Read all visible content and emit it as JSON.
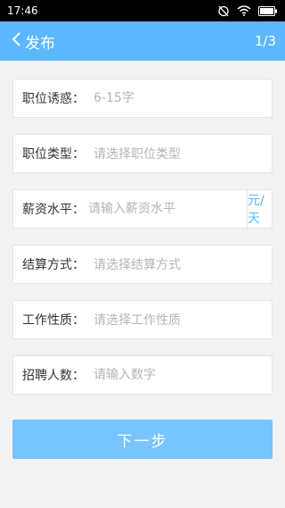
{
  "status_bar": {
    "time": "17:46",
    "battery_icon": "battery-icon",
    "wifi_icon": "wifi-icon",
    "alarm_icon": "alarm-off-icon"
  },
  "header": {
    "title": "发布",
    "page_indicator": "1/3",
    "back_icon": "chevron-left-icon",
    "bg_color": "#5bb8ff"
  },
  "form": {
    "fields": [
      {
        "label": "职位诱惑：",
        "placeholder": "6-15字",
        "value": ""
      },
      {
        "label": "职位类型：",
        "placeholder": "请选择职位类型",
        "value": ""
      },
      {
        "label": "薪资水平：",
        "placeholder": "请输入薪资水平",
        "value": "",
        "unit": "元/天"
      },
      {
        "label": "结算方式：",
        "placeholder": "请选择结算方式",
        "value": ""
      },
      {
        "label": "工作性质：",
        "placeholder": "请选择工作性质",
        "value": ""
      },
      {
        "label": "招聘人数：",
        "placeholder": "请输入数字",
        "value": ""
      }
    ]
  },
  "actions": {
    "next_label": "下一步",
    "button_color": "#78c4fe"
  }
}
